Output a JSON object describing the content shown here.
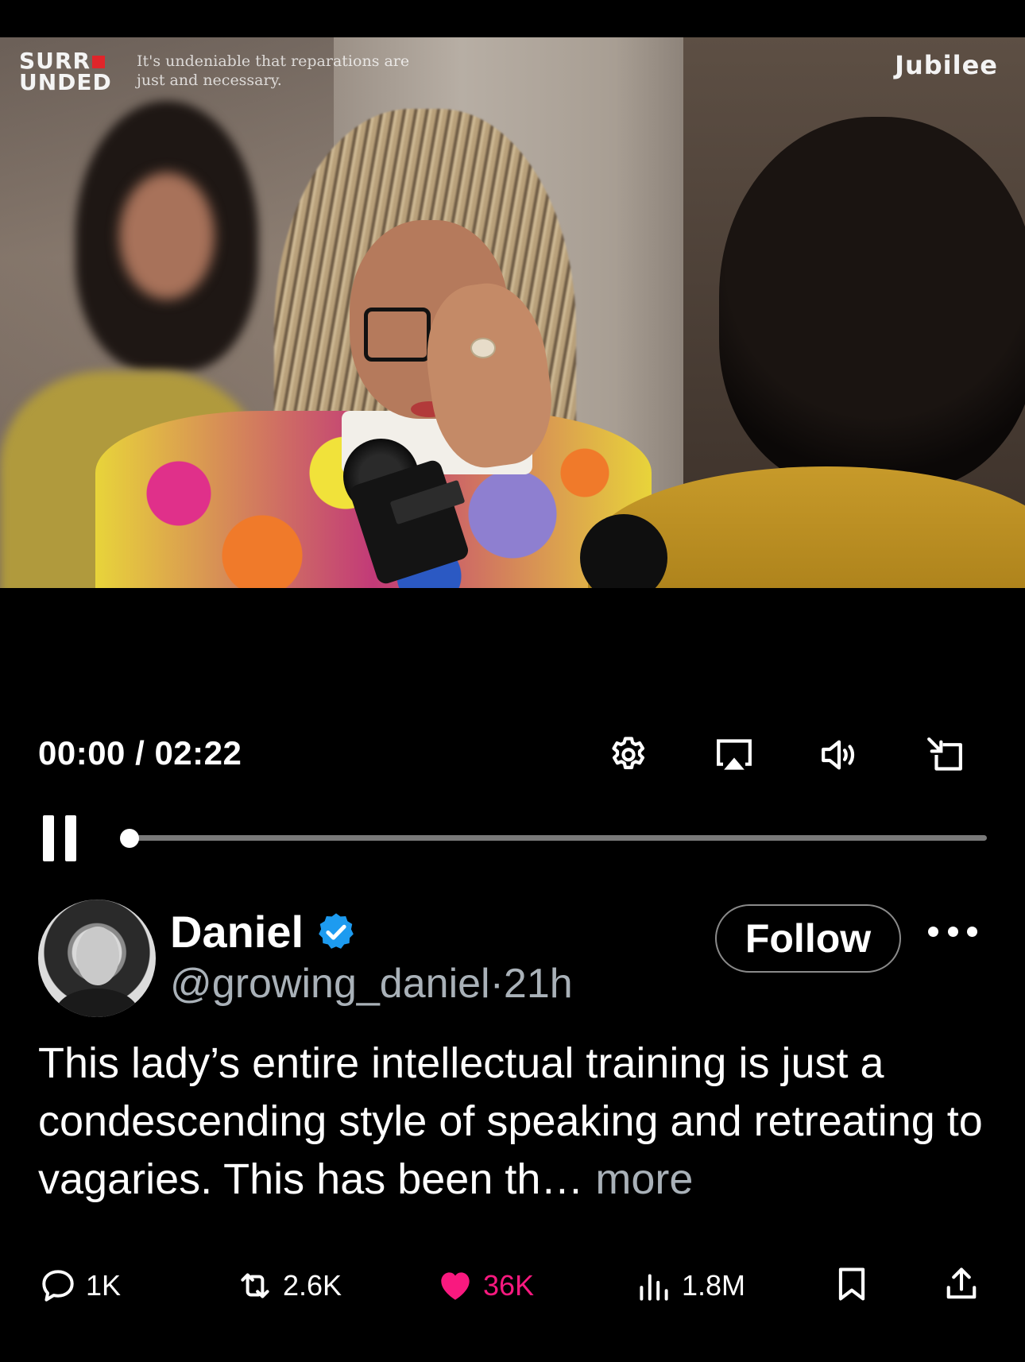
{
  "video": {
    "overlay_logo_line1": "SURR",
    "overlay_logo_line2": "UNDED",
    "overlay_caption": "It's undeniable that reparations are just and necessary.",
    "overlay_brand": "Jubilee"
  },
  "player": {
    "current_time": "00:00",
    "separator": "/",
    "duration": "02:22",
    "progress_fraction": 0.0,
    "icons": {
      "settings": "gear-icon",
      "airplay": "airplay-icon",
      "volume": "volume-icon",
      "minimize": "minimize-icon",
      "pause": "pause-icon"
    }
  },
  "post": {
    "author_name": "Daniel",
    "verified": true,
    "handle": "@growing_daniel",
    "time_separator": "·",
    "time_ago": "21h",
    "follow_label": "Follow",
    "text": "This lady’s entire intellectual training is just a condescending style of speaking and retreating to vagaries. This has been th…",
    "more_label": " more"
  },
  "actions": {
    "replies": "1K",
    "reposts": "2.6K",
    "likes": "36K",
    "views": "1.8M"
  },
  "colors": {
    "background": "#000000",
    "secondary_text": "#a9b1b8",
    "like_active": "#f9197f",
    "verified_badge": "#1d9bf0"
  }
}
